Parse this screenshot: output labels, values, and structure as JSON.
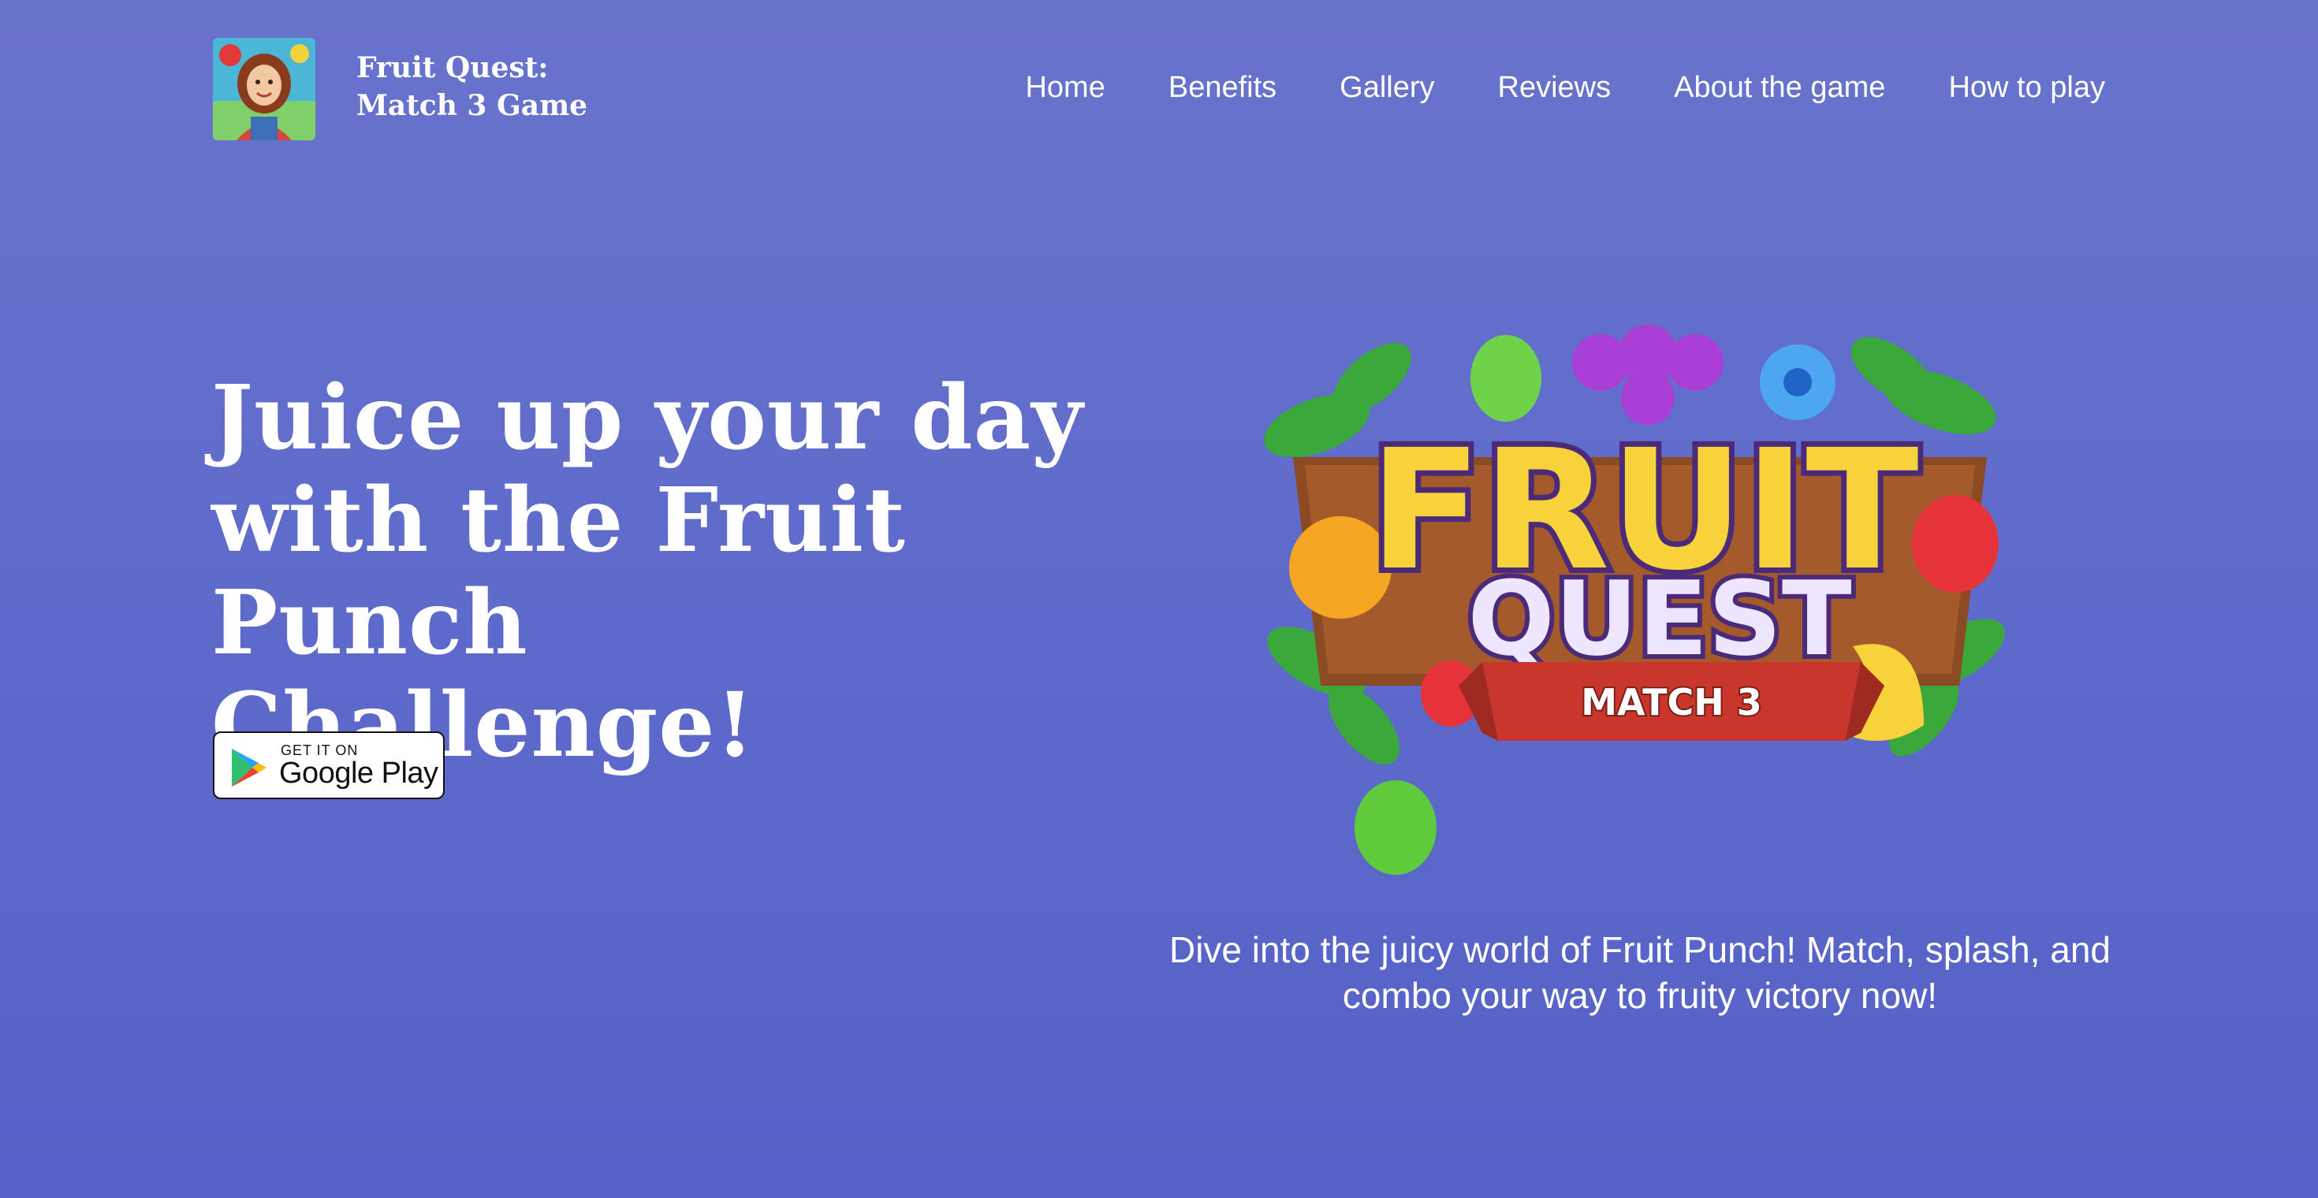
{
  "header": {
    "logo_icon": "character-avatar-icon",
    "brand_line1": "Fruit Quest:",
    "brand_line2": "Match 3 Game",
    "nav": [
      {
        "label": "Home"
      },
      {
        "label": "Benefits"
      },
      {
        "label": "Gallery"
      },
      {
        "label": "Reviews"
      },
      {
        "label": "About the game"
      },
      {
        "label": "How to play"
      }
    ]
  },
  "hero": {
    "title_line1": "Juice up your day",
    "title_line2": "with the Fruit Punch",
    "title_line3": "Challenge!",
    "store_badge": {
      "small_text": "GET IT ON",
      "store_name": "Google Play",
      "icon": "google-play-icon"
    },
    "game_logo": {
      "line1": "FRUIT",
      "line2": "QUEST",
      "ribbon": "MATCH 3"
    },
    "description": "Dive into the juicy world of Fruit Punch! Match, splash, and combo your way to fruity victory now!"
  },
  "colors": {
    "background": "#6270cb",
    "text": "#ffffff",
    "logo_yellow": "#f7d23a",
    "logo_purple": "#4b2a7a",
    "ribbon_red": "#c9372c"
  }
}
